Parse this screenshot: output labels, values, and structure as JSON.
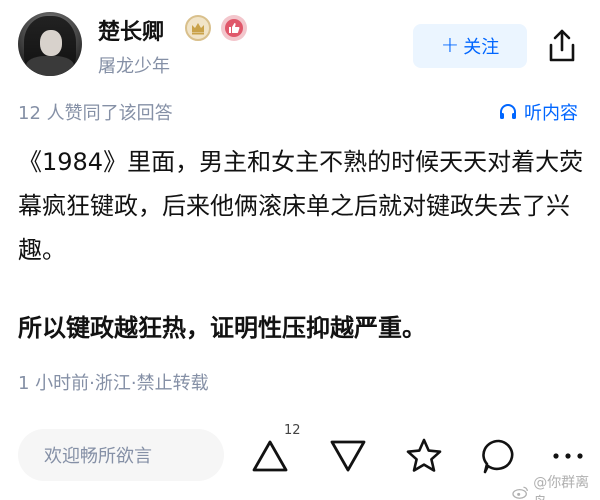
{
  "author": {
    "name": "楚长卿",
    "bio": "屠龙少年"
  },
  "follow_button": {
    "label": "关注"
  },
  "answer": {
    "upvote_summary": "12 人赞同了该回答",
    "listen_label": "听内容",
    "paragraph_1": "《1984》里面，男主和女主不熟的时候天天对着大荧幕疯狂键政，后来他俩滚床单之后就对键政失去了兴趣。",
    "paragraph_2": "所以键政越狂热，证明性压抑越严重。",
    "meta": "1 小时前·浙江·禁止转载"
  },
  "bottom_bar": {
    "comment_placeholder": "欢迎畅所欲言",
    "upvote_count": "12"
  },
  "watermark": {
    "text": "@你群离岛"
  },
  "colors": {
    "accent": "#0066ff",
    "secondary_text": "#8590a6",
    "follow_bg": "#ebf5ff"
  },
  "icons": [
    "share-icon",
    "headphones-icon",
    "upvote-icon",
    "downvote-icon",
    "star-icon",
    "comment-icon",
    "more-icon",
    "crown-badge-icon",
    "like-badge-icon",
    "weibo-icon"
  ]
}
